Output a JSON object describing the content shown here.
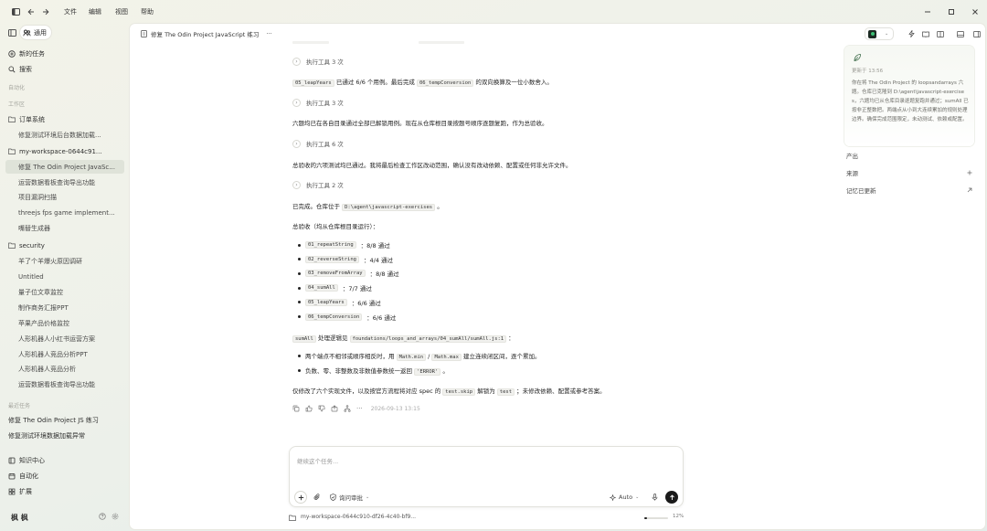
{
  "titlebar": {
    "menu": [
      "文件",
      "编辑",
      "视图",
      "帮助"
    ]
  },
  "sidebar": {
    "mode_label": "通用",
    "new_task": "新的任务",
    "search": "搜索",
    "automation_label": "自动化",
    "workspace_label": "工作区",
    "items": [
      {
        "label": "订单系统",
        "type": "folder"
      },
      {
        "label": "修复测试环境后台数据加载...",
        "type": "sub"
      },
      {
        "label": "my-workspace-0644c91...",
        "type": "folder"
      },
      {
        "label": "修复 The Odin Project JavaSc...",
        "type": "sub",
        "selected": true
      },
      {
        "label": "运营数据看板查询导出功能",
        "type": "sub"
      },
      {
        "label": "项目漏洞扫描",
        "type": "sub"
      },
      {
        "label": "threejs fps game implement...",
        "type": "sub"
      },
      {
        "label": "嘴替生成器",
        "type": "sub"
      },
      {
        "label": "security",
        "type": "folder"
      },
      {
        "label": "羊了个羊爆火原因调研",
        "type": "sub"
      },
      {
        "label": "Untitled",
        "type": "sub"
      },
      {
        "label": "量子位文章监控",
        "type": "sub"
      },
      {
        "label": "制作商务汇报PPT",
        "type": "sub"
      },
      {
        "label": "苹果产品价格监控",
        "type": "sub"
      },
      {
        "label": "人形机器人小红书运营方案",
        "type": "sub"
      },
      {
        "label": "人形机器人竞品分析PPT",
        "type": "sub"
      },
      {
        "label": "人形机器人竞品分析",
        "type": "sub"
      },
      {
        "label": "运营数据看板查询导出功能",
        "type": "sub"
      }
    ],
    "recent_label": "最近任务",
    "recent": [
      "修复 The Odin Project JS 练习",
      "修复测试环境数据加载异常"
    ],
    "bottom": [
      "知识中心",
      "自动化",
      "扩展"
    ],
    "user": "枫 枫"
  },
  "main": {
    "breadcrumb": "修复 The Odin Project JavaScript 练习",
    "breadcrumb_more": "···",
    "tool1": "执行工具 3 次",
    "p1_a": "05_leapYears",
    "p1_b": "已通过 6/6 个用例。最后完成",
    "p1_c": "06_tempConversion",
    "p1_d": "的双向换算及一位小数舍入。",
    "tool2": "执行工具 3 次",
    "p2": "六题均已在各自目录通过全部已解锁用例。现在从仓库根目录按题号顺序逐题复跑，作为总验收。",
    "tool3": "执行工具 6 次",
    "p3": "总验收的六项测试均已通过。我将最后检查工作区改动范围，确认没有改动依赖、配置或任何非允许文件。",
    "tool4": "执行工具 2 次",
    "p4_a": "已完成。仓库位于",
    "p4_b": "D:\\agent\\javascript-exercises",
    "p4_c": "。",
    "p5": "总验收（均从仓库根目录运行）：",
    "results": [
      {
        "code": "01_repeatString",
        "text": "：8/8 通过"
      },
      {
        "code": "02_reverseString",
        "text": "：4/4 通过"
      },
      {
        "code": "03_removeFromArray",
        "text": "：8/8 通过"
      },
      {
        "code": "04_sumAll",
        "text": "：7/7 通过"
      },
      {
        "code": "05_leapYears",
        "text": "：6/6 通过"
      },
      {
        "code": "06_tempConversion",
        "text": "：6/6 通过"
      }
    ],
    "p6_a": "sumAll",
    "p6_b": "处理逻辑见",
    "p6_c": "foundations/loops_and_arrays/04_sumAll/sumAll.js:1",
    "p6_d": "：",
    "b1_a": "两个端点不相邻或顺序相反时，用",
    "b1_b": "Math.min",
    "b1_c": "/",
    "b1_d": "Math.max",
    "b1_e": "建立连续闭区间，逐个累加。",
    "b2_a": "负数、零、非整数及非数值参数统一返回",
    "b2_b": "'ERROR'",
    "b2_c": "。",
    "p7_a": "仅修改了六个实现文件，以及按官方流程将对应 spec 的",
    "p7_b": "test.skip",
    "p7_c": "解锁为",
    "p7_d": "test",
    "p7_e": "；未修改依赖、配置或参考答案。",
    "timestamp": "2026-09-13 13:15",
    "input_placeholder": "继续这个任务...",
    "ask_label": "询问审批",
    "auto_label": "Auto",
    "workspace_path": "my-workspace-0644c910-df26-4c40-bf9...",
    "progress_label": "12%",
    "progress": 0.12
  },
  "right": {
    "updated": "更新于 13:56",
    "note": "你在将 The Odin Project 的 loopsandarrays 六题。仓库已克隆到 D:\\agent\\javascript-exercises，六题均已从仓库目录逐题复跑并通过；sumAll 已按非正整数把。两端点从小到大连续累加的规则处理边界。确保完成范围限定，未动测试、依赖或配置。",
    "outputs": "产出",
    "sources": "来源",
    "memory": "记忆已更新"
  }
}
